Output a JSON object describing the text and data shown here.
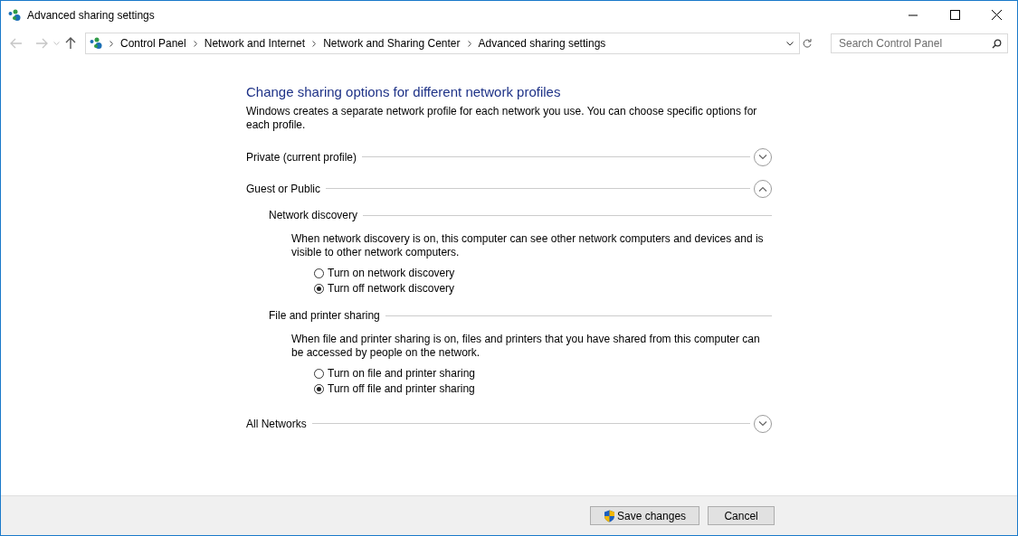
{
  "window": {
    "title": "Advanced sharing settings"
  },
  "breadcrumb": [
    "Control Panel",
    "Network and Internet",
    "Network and Sharing Center",
    "Advanced sharing settings"
  ],
  "search": {
    "placeholder": "Search Control Panel"
  },
  "heading": "Change sharing options for different network profiles",
  "intro": "Windows creates a separate network profile for each network you use. You can choose specific options for each profile.",
  "profiles": [
    {
      "label": "Private (current profile)",
      "expanded": false
    },
    {
      "label": "Guest or Public",
      "expanded": true,
      "sections": [
        {
          "title": "Network discovery",
          "description": "When network discovery is on, this computer can see other network computers and devices and is visible to other network computers.",
          "options": [
            {
              "label": "Turn on network discovery",
              "selected": false
            },
            {
              "label": "Turn off network discovery",
              "selected": true
            }
          ]
        },
        {
          "title": "File and printer sharing",
          "description": "When file and printer sharing is on, files and printers that you have shared from this computer can be accessed by people on the network.",
          "options": [
            {
              "label": "Turn on file and printer sharing",
              "selected": false
            },
            {
              "label": "Turn off file and printer sharing",
              "selected": true
            }
          ]
        }
      ]
    },
    {
      "label": "All Networks",
      "expanded": false
    }
  ],
  "buttons": [
    {
      "label": "Save changes",
      "kind": "shield"
    },
    {
      "label": "Cancel",
      "kind": "plain"
    }
  ]
}
